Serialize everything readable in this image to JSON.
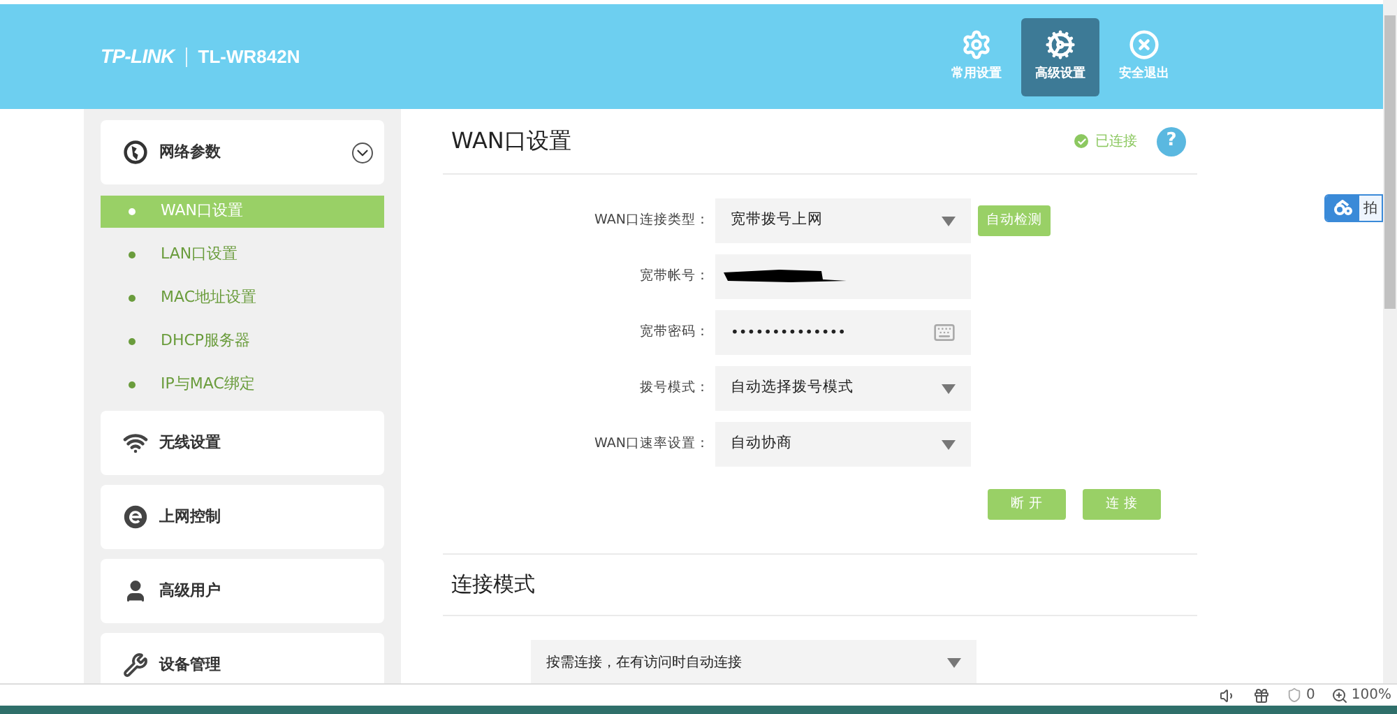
{
  "header": {
    "brand": "TP-LINK",
    "model": "TL-WR842N",
    "nav": [
      {
        "label": "常用设置",
        "selected": false
      },
      {
        "label": "高级设置",
        "selected": true
      },
      {
        "label": "安全退出",
        "selected": false
      }
    ]
  },
  "sidebar": [
    {
      "label": "网络参数",
      "children": [
        {
          "label": "WAN口设置",
          "selected": true
        },
        {
          "label": "LAN口设置",
          "selected": false
        },
        {
          "label": "MAC地址设置",
          "selected": false
        },
        {
          "label": "DHCP服务器",
          "selected": false
        },
        {
          "label": "IP与MAC绑定",
          "selected": false
        }
      ]
    },
    {
      "label": "无线设置"
    },
    {
      "label": "上网控制"
    },
    {
      "label": "高级用户"
    },
    {
      "label": "设备管理"
    }
  ],
  "wan": {
    "title": "WAN口设置",
    "status": "已连接",
    "connected": true,
    "help": "?",
    "fields": [
      {
        "label": "WAN口连接类型：",
        "kind": "select",
        "value": "宽带拨号上网",
        "button": "自动检测"
      },
      {
        "label": "宽带帐号：",
        "kind": "redacted"
      },
      {
        "label": "宽带密码：",
        "kind": "password",
        "value": "••••••••••••••"
      },
      {
        "label": "拨号模式：",
        "kind": "select",
        "value": "自动选择拨号模式"
      },
      {
        "label": "WAN口速率设置：",
        "kind": "select",
        "value": "自动协商"
      }
    ],
    "buttons": [
      "断 开",
      "连 接"
    ]
  },
  "mode": {
    "title": "连接模式",
    "value": "按需连接，在有访问时自动连接"
  },
  "side_tab": {
    "text": "拍"
  },
  "status_bar": {
    "blocked": "0",
    "zoom": "100%"
  }
}
